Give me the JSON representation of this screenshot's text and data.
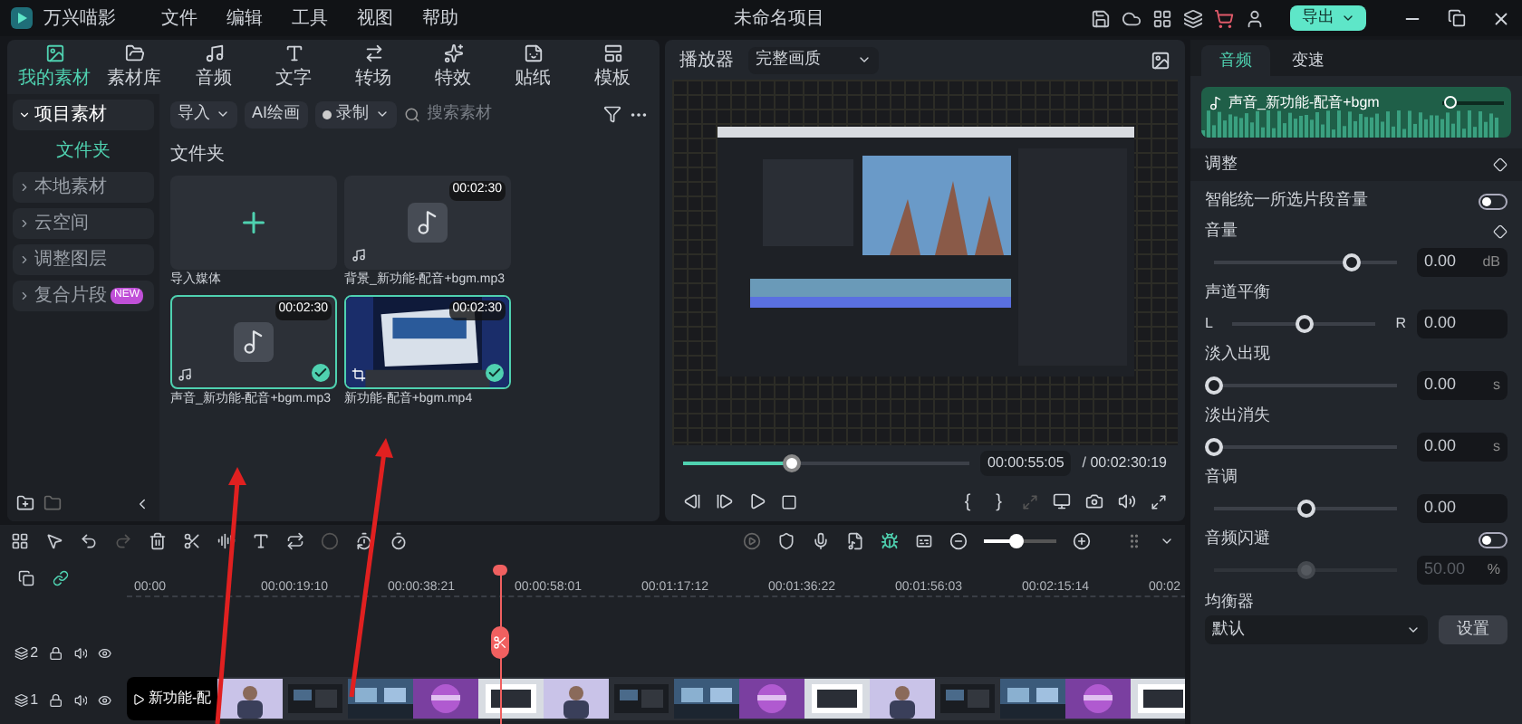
{
  "titlebar": {
    "app_name": "万兴喵影",
    "menus": [
      "文件",
      "编辑",
      "工具",
      "视图",
      "帮助"
    ],
    "project_title": "未命名项目",
    "export_button": "导出"
  },
  "media_tabs": [
    {
      "label": "我的素材",
      "selected": true
    },
    {
      "label": "素材库",
      "selected": false
    },
    {
      "label": "音频",
      "selected": false
    },
    {
      "label": "文字",
      "selected": false
    },
    {
      "label": "转场",
      "selected": false
    },
    {
      "label": "特效",
      "selected": false
    },
    {
      "label": "贴纸",
      "selected": false
    },
    {
      "label": "模板",
      "selected": false
    }
  ],
  "sidebar": {
    "items": [
      {
        "label": "项目素材",
        "selected": false,
        "expanded": true,
        "children": [
          {
            "label": "文件夹",
            "selected": true
          }
        ]
      },
      {
        "label": "本地素材",
        "selected": false,
        "expanded": false
      },
      {
        "label": "云空间",
        "selected": false,
        "expanded": false
      },
      {
        "label": "调整图层",
        "selected": false,
        "expanded": false
      },
      {
        "label": "复合片段",
        "selected": false,
        "expanded": false,
        "badge": "NEW"
      }
    ]
  },
  "media_toolbar": {
    "import": "导入",
    "ai": "AI绘画",
    "record": "录制",
    "search": {
      "placeholder": "搜索素材"
    }
  },
  "media": {
    "heading": "文件夹",
    "import_tile": "导入媒体",
    "cards": [
      {
        "kind": "audio",
        "name": "背景_新功能-配音+bgm.mp3",
        "duration": "00:02:30",
        "selected": false
      },
      {
        "kind": "audio",
        "name": "声音_新功能-配音+bgm.mp3",
        "duration": "00:02:30",
        "selected": true
      },
      {
        "kind": "video",
        "name": "新功能-配音+bgm.mp4",
        "duration": "00:02:30",
        "selected": true
      }
    ]
  },
  "player": {
    "label": "播放器",
    "quality": "完整画质",
    "progress": {
      "level": 0.38
    },
    "current_time": "00:00:55:05",
    "total_time": "/ 00:02:30:19",
    "marks": [
      "{",
      "}"
    ]
  },
  "inspector": {
    "tabs": [
      {
        "label": "音频",
        "selected": true
      },
      {
        "label": "变速",
        "selected": false
      }
    ],
    "clip": {
      "name": "声音_新功能-配音+bgm",
      "volume": {
        "level": 0.12
      }
    },
    "section": "调整",
    "controls": [
      {
        "kind": "toggle",
        "label": "智能统一所选片段音量",
        "on": false
      },
      {
        "kind": "slider",
        "label": "音量",
        "level": 0.75,
        "value": "0.00",
        "unit": "dB",
        "keyframe": true
      },
      {
        "kind": "balance",
        "label": "声道平衡",
        "left": "L",
        "right": "R",
        "level": 0.5,
        "value": "0.00"
      },
      {
        "kind": "slider",
        "label": "淡入出现",
        "level": 0,
        "value": "0.00",
        "unit": "s"
      },
      {
        "kind": "slider",
        "label": "淡出消失",
        "level": 0,
        "value": "0.00",
        "unit": "s"
      },
      {
        "kind": "slider",
        "label": "音调",
        "level": 0.5,
        "value": "0.00"
      },
      {
        "kind": "ducking",
        "label": "音频闪避",
        "on": false,
        "level": 0.5,
        "value": "50.00",
        "unit": "%"
      },
      {
        "kind": "select",
        "label": "均衡器",
        "value": "默认",
        "button": "设置"
      }
    ]
  },
  "timeline": {
    "zoom": {
      "level": 0.45
    },
    "ruler": [
      "00:00",
      "00:00:19:10",
      "00:00:38:21",
      "00:00:58:01",
      "00:01:17:12",
      "00:01:36:22",
      "00:01:56:03",
      "00:02:15:14",
      "00:02"
    ],
    "tracks": [
      {
        "number": "2"
      },
      {
        "number": "1"
      }
    ],
    "clip": {
      "label": "新功能-配"
    }
  }
}
